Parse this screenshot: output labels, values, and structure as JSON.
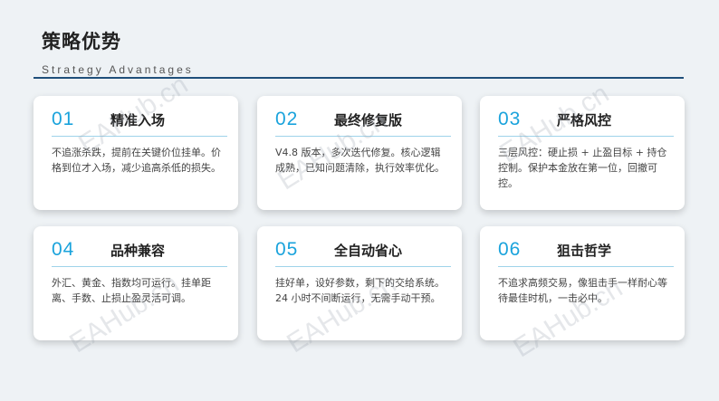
{
  "header": {
    "title": "策略优势",
    "subtitle": "Strategy Advantages"
  },
  "cards": [
    {
      "num": "01",
      "title": "精准入场",
      "body": "不追涨杀跌，提前在关键价位挂单。价格到位才入场，减少追高杀低的损失。"
    },
    {
      "num": "02",
      "title": "最终修复版",
      "body": "V4.8 版本，多次迭代修复。核心逻辑成熟，已知问题清除，执行效率优化。"
    },
    {
      "num": "03",
      "title": "严格风控",
      "body": "三层风控：硬止损 + 止盈目标 + 持仓控制。保护本金放在第一位，回撤可控。"
    },
    {
      "num": "04",
      "title": "品种兼容",
      "body": "外汇、黄金、指数均可运行。挂单距离、手数、止损止盈灵活可调。"
    },
    {
      "num": "05",
      "title": "全自动省心",
      "body": "挂好单，设好参数，剩下的交给系统。24 小时不间断运行，无需手动干预。"
    },
    {
      "num": "06",
      "title": "狙击哲学",
      "body": "不追求高频交易，像狙击手一样耐心等待最佳时机，一击必中。"
    }
  ],
  "watermark": "EAHub.cn"
}
